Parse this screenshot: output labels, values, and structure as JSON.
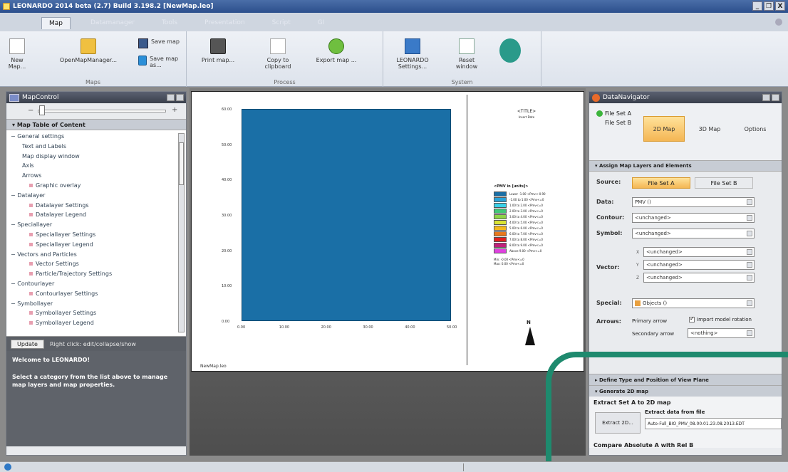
{
  "window": {
    "title": "LEONARDO 2014 beta (2.7) Build 3.198.2 [NewMap.leo]",
    "controls": [
      "_",
      "❐",
      "X"
    ]
  },
  "tabs": [
    {
      "label": "Map",
      "active": true
    },
    {
      "label": "Datamanager",
      "active": false
    },
    {
      "label": "Tools",
      "active": false
    },
    {
      "label": "Presentation",
      "active": false
    },
    {
      "label": "Script",
      "active": false
    },
    {
      "label": "GI",
      "active": false
    }
  ],
  "ribbon": {
    "groups": {
      "maps": "Maps",
      "process": "Process",
      "system": "System"
    },
    "new_map": "New Map...",
    "open_map_manager": "OpenMapManager...",
    "save_map": "Save map",
    "save_map_as": "Save map as...",
    "print_map": "Print map...",
    "copy_clipboard": "Copy to clipboard",
    "export_map": "Export map ...",
    "leonardo_settings": "LEONARDO Settings...",
    "reset_window": "Reset window"
  },
  "map_control": {
    "title": "MapControl",
    "toc_title": "Map Table of Content",
    "tree": [
      {
        "label": "General settings",
        "level": 0
      },
      {
        "label": "Text and Labels",
        "level": 1
      },
      {
        "label": "Map display window",
        "level": 1
      },
      {
        "label": "Axis",
        "level": 1
      },
      {
        "label": "Arrows",
        "level": 1
      },
      {
        "label": "Graphic overlay",
        "level": 2
      },
      {
        "label": "Datalayer",
        "level": 0
      },
      {
        "label": "Datalayer Settings",
        "level": 2
      },
      {
        "label": "Datalayer Legend",
        "level": 2
      },
      {
        "label": "Speciallayer",
        "level": 0
      },
      {
        "label": "Speciallayer Settings",
        "level": 2
      },
      {
        "label": "Speciallayer Legend",
        "level": 2
      },
      {
        "label": "Vectors and Particles",
        "level": 0
      },
      {
        "label": "Vector Settings",
        "level": 2
      },
      {
        "label": "Particle/Trajectory Settings",
        "level": 2
      },
      {
        "label": "Contourlayer",
        "level": 0
      },
      {
        "label": "Contourlayer Settings",
        "level": 2
      },
      {
        "label": "Symbollayer",
        "level": 0
      },
      {
        "label": "Symbollayer Settings",
        "level": 2
      },
      {
        "label": "Symbollayer Legend",
        "level": 2
      }
    ],
    "update_button": "Update",
    "update_hint": "Right click: edit/collapse/show",
    "welcome_title": "Welcome to LEONARDO!",
    "welcome_text": "Select a category from the list above to manage map layers and map properties."
  },
  "map": {
    "title": "<TITLE>",
    "subtitle": "Insert Date",
    "y_ticks": [
      "60.00",
      "50.00",
      "40.00",
      "30.00",
      "20.00",
      "10.00",
      "0.00"
    ],
    "x_ticks": [
      "0.00",
      "10.00",
      "20.00",
      "30.00",
      "40.00",
      "50.00"
    ],
    "footer": "NewMap.leo",
    "plot_color": "#1a6fa6",
    "legend": {
      "title": "<PMV in [units]>",
      "entries": [
        {
          "label": "Lower -1.00 <Pmv<-0.90",
          "color": "#1a6fa6"
        },
        {
          "label": "-1.00 to 1.00 <Pmv<=0",
          "color": "#2aa3d8"
        },
        {
          "label": "1.00 to 2.00 <Pmv<=0",
          "color": "#3ad0e8"
        },
        {
          "label": "2.00 to 3.00 <Pmv<=0",
          "color": "#42c878"
        },
        {
          "label": "3.00 to 4.00 <Pmv<=0",
          "color": "#8ed448"
        },
        {
          "label": "4.00 to 5.00 <Pmv<=0",
          "color": "#d8e234"
        },
        {
          "label": "5.00 to 6.00 <Pmv<=0",
          "color": "#f2b81c"
        },
        {
          "label": "6.00 to 7.00 <Pmv<=0",
          "color": "#e8781c"
        },
        {
          "label": "7.00 to 8.00 <Pmv<=0",
          "color": "#e02020"
        },
        {
          "label": "8.00 to 9.00 <Pmv<=0",
          "color": "#c0207a"
        },
        {
          "label": "Above 9.00 <Pmv<=0",
          "color": "#e040e0"
        }
      ],
      "min": "Min: -0.00 <Pmv<=0",
      "max": "Max: 0.00 <Pmv<=0"
    }
  },
  "data_navigator": {
    "title": "DataNavigator",
    "file_set_a": "File Set A",
    "file_set_b": "File Set B",
    "tabs": [
      {
        "label": "2D Map",
        "active": true
      },
      {
        "label": "3D Map",
        "active": false
      },
      {
        "label": "Options",
        "active": false
      }
    ],
    "assign_section": "Assign Map Layers and Elements",
    "source_label": "Source:",
    "source_a": "File Set A",
    "source_b": "File Set B",
    "data_label": "Data:",
    "data_value": "PMV ()",
    "contour_label": "Contour:",
    "contour_value": "<unchanged>",
    "symbol_label": "Symbol:",
    "symbol_value": "<unchanged>",
    "vector_label": "Vector:",
    "vector_values": [
      {
        "num": "X",
        "value": "<unchanged>"
      },
      {
        "num": "Y",
        "value": "<unchanged>"
      },
      {
        "num": "Z",
        "value": "<unchanged>"
      }
    ],
    "special_label": "Special:",
    "special_value": "Objects ()",
    "arrows_label": "Arrows:",
    "primary_arrow": "Primary arrow",
    "import_model_option": "Import model rotation",
    "secondary_arrow": "Secondary arrow",
    "secondary_value": "<nothing>",
    "define_section": "Define Type and Position of View Plane",
    "generate_section": "Generate 2D map",
    "extract_title": "Extract Set A to 2D map",
    "extract_button": "Extract 2D...",
    "extract_from_file": "Extract data from file",
    "extract_filename": "Auto-Full_BIO_PMV_08.00.01.23.08.2013.EDT",
    "compare_title": "Compare Absolute A with Rel B"
  },
  "colors": {
    "accent_green": "#1e8a6e",
    "active_orange": "#f4b654"
  }
}
